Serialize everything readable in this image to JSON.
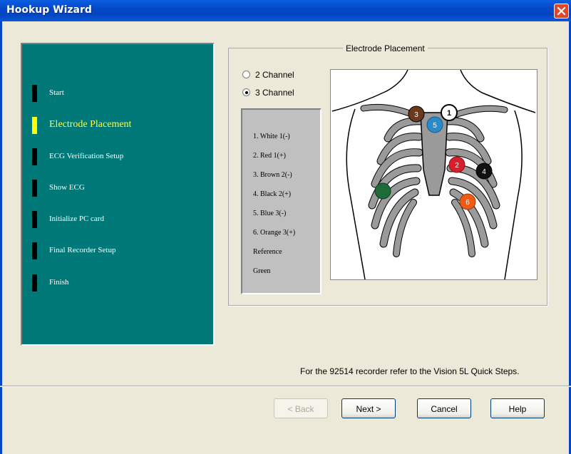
{
  "window": {
    "title": "Hookup Wizard"
  },
  "steps": [
    {
      "label": "Start",
      "active": false
    },
    {
      "label": "Electrode Placement",
      "active": true
    },
    {
      "label": "ECG Verification Setup",
      "active": false
    },
    {
      "label": "Show ECG",
      "active": false
    },
    {
      "label": "Initialize PC card",
      "active": false
    },
    {
      "label": "Final Recorder Setup",
      "active": false
    },
    {
      "label": "Finish",
      "active": false
    }
  ],
  "group": {
    "title": "Electrode Placement"
  },
  "channels": [
    {
      "label": "2 Channel",
      "selected": false
    },
    {
      "label": "3 Channel",
      "selected": true
    }
  ],
  "legend": [
    "1. White 1(-)",
    "2. Red  1(+)",
    "3. Brown 2(-)",
    "4. Black 2(+)",
    "5. Blue 3(-)",
    "6. Orange 3(+)",
    "Reference",
    "Green"
  ],
  "electrodes": [
    {
      "num": "3",
      "color": "#6b3a1e"
    },
    {
      "num": "1",
      "color": "#ffffff"
    },
    {
      "num": "5",
      "color": "#2b8acb"
    },
    {
      "num": "2",
      "color": "#d8202a"
    },
    {
      "num": "4",
      "color": "#111111"
    },
    {
      "num": "",
      "color": "#1e6b3a"
    },
    {
      "num": "6",
      "color": "#f05a14"
    }
  ],
  "info": "For the 92514 recorder refer to the Vision 5L Quick Steps.",
  "buttons": {
    "back": "< Back",
    "next": "Next >",
    "cancel": "Cancel",
    "help": "Help"
  },
  "colors": {
    "nav_bg": "#007878",
    "titlebar": "#0448c8",
    "active_step": "#ffff00",
    "dialog_bg": "#ece9d8"
  }
}
